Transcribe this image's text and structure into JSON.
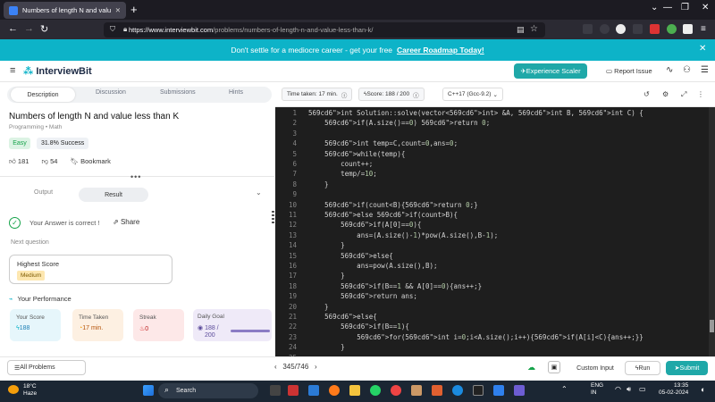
{
  "browser": {
    "tab_title": "Numbers of length N and valu",
    "url_host": "https://www.interviewbit.com",
    "url_path": "/problems/numbers-of-length-n-and-value-less-than-k/"
  },
  "banner": {
    "text": "Don't settle for a mediocre career - get your free",
    "link": "Career Roadmap Today!"
  },
  "header": {
    "logo": "InterviewBit",
    "experience_btn": "Experience Scaler",
    "report": "Report Issue"
  },
  "tabs": [
    "Description",
    "Discussion",
    "Submissions",
    "Hints"
  ],
  "problem": {
    "title": "Numbers of length N and value less than K",
    "category": "Programming • Math",
    "difficulty": "Easy",
    "success": "31.8% Success",
    "likes": "181",
    "dislikes": "54",
    "bookmark": "Bookmark"
  },
  "result_tabs": {
    "output": "Output",
    "result": "Result"
  },
  "result": {
    "message": "Your Answer is correct !",
    "share": "Share",
    "next": "Next question",
    "highest_label": "Highest Score",
    "highest_level": "Medium"
  },
  "performance": {
    "title": "Your Performance",
    "score_label": "Your Score",
    "score": "188",
    "time_label": "Time Taken",
    "time": "17 min.",
    "streak_label": "Streak",
    "streak": "0",
    "goal_label": "Daily Goal",
    "goal": "188 /",
    "goal_total": "200"
  },
  "editor": {
    "time": "Time taken: 17 min.",
    "score": "Score: 188 / 200",
    "lang": "C++17 (Gcc-9.2)"
  },
  "code_lines": [
    "int Solution::solve(vector<int> &A, int B, int C) {",
    "    if(A.size()==0) return 0;",
    "",
    "    int temp=C,count=0,ans=0;",
    "    while(temp){",
    "        count++;",
    "        temp/=10;",
    "    }",
    "",
    "    if(count<B){return 0;}",
    "    else if(count>B){",
    "        if(A[0]==0){",
    "            ans=(A.size()-1)*pow(A.size(),B-1);",
    "        }",
    "        else{",
    "            ans=pow(A.size(),B);",
    "        }",
    "        if(B==1 && A[0]==0){ans++;}",
    "        return ans;",
    "    }",
    "    else{",
    "        if(B==1){",
    "            for(int i=0;i<A.size();i++){if(A[i]<C){ans++;}}",
    "        }",
    "        ..."
  ],
  "bottom": {
    "all_problems": "All Problems",
    "pager": "345/746",
    "custom_input": "Custom Input",
    "run": "Run",
    "submit": "Submit"
  },
  "taskbar": {
    "temp": "18°C",
    "weather": "Haze",
    "search": "Search",
    "lang1": "ENG",
    "lang2": "IN",
    "time": "13:35",
    "date": "05-02-2024"
  },
  "colors": {
    "accent": "#1fa8a8",
    "banner": "#0db3c8",
    "editor_bg": "#1e1e1e",
    "keyword": "#569cd6",
    "number": "#b5cea8"
  }
}
